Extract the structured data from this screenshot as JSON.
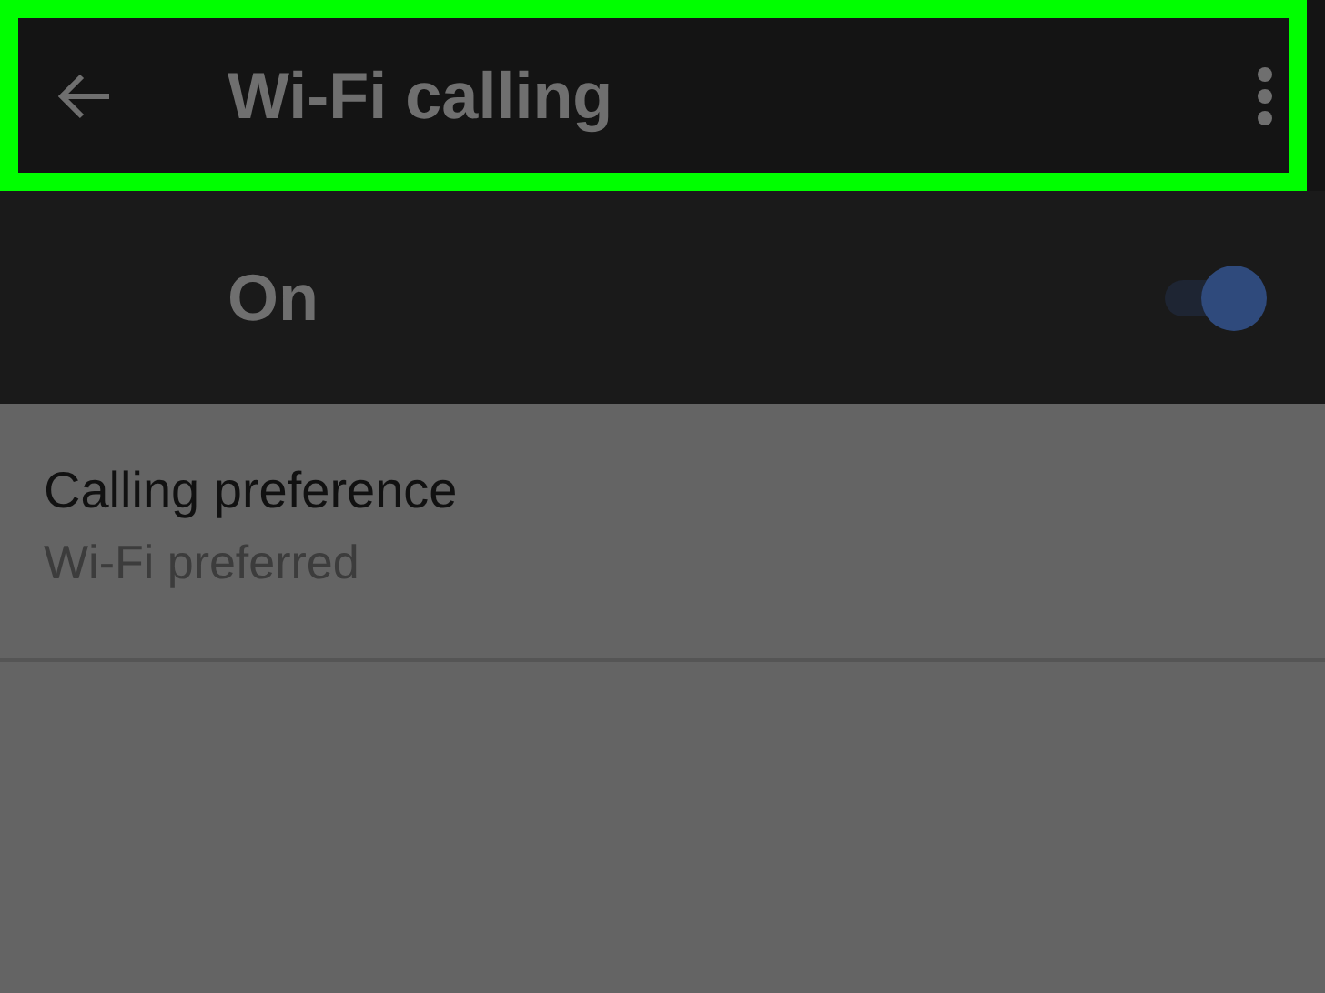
{
  "toolbar": {
    "title": "Wi-Fi calling"
  },
  "master_switch": {
    "label": "On",
    "on": true
  },
  "preferences": [
    {
      "title": "Calling preference",
      "summary": "Wi-Fi preferred"
    }
  ]
}
